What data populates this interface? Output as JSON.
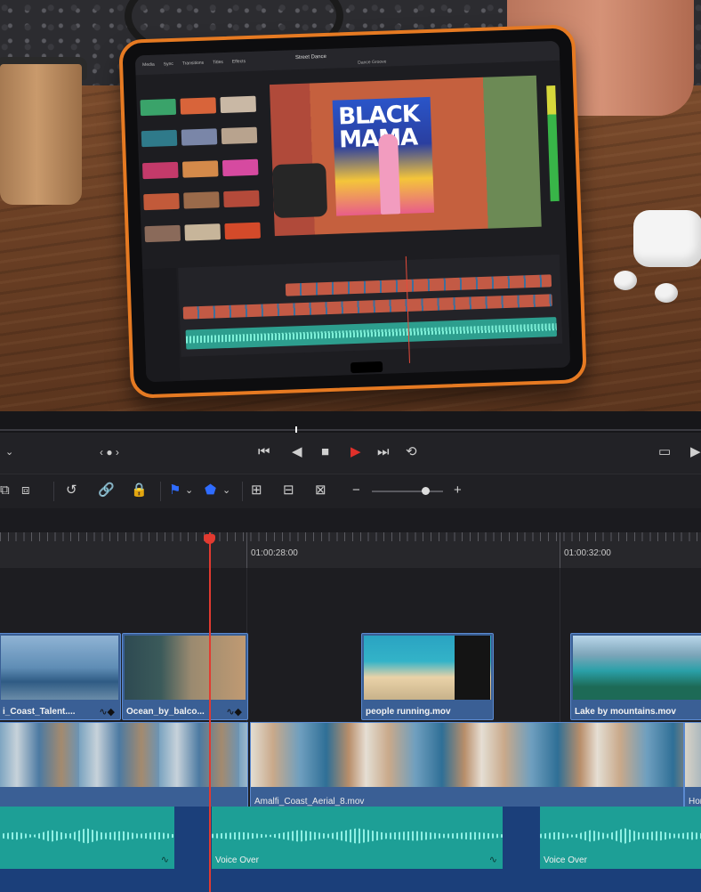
{
  "photo": {
    "ipad_screen": {
      "project_name": "Street Dance",
      "clip_name": "Dance Groove",
      "tabs": [
        "Media",
        "Sync",
        "Transitions",
        "Titles",
        "Effects"
      ],
      "mural_text": "BLACK MAMA"
    }
  },
  "transport": {
    "icons": [
      "chevron-down-icon",
      "prev-next-dots-icon",
      "skip-to-start-icon",
      "step-back-icon",
      "stop-icon",
      "play-icon",
      "skip-to-end-icon",
      "loop-icon",
      "fullscreen-icon",
      "next-frame-icon"
    ],
    "accent": "#e0302a"
  },
  "toolbar": {
    "icons": [
      "insert-clip-icon",
      "overwrite-clip-icon",
      "snapping-icon",
      "link-icon",
      "lock-icon",
      "flag-icon",
      "marker-icon",
      "zoom-full-icon",
      "zoom-detail-icon",
      "zoom-custom-icon",
      "zoom-out-icon",
      "zoom-in-icon"
    ],
    "zoom_minus": "−",
    "zoom_plus": "+",
    "marker_color": "#2f6cff"
  },
  "ruler": {
    "timecodes": [
      "01:00:28:00",
      "01:00:32:00"
    ]
  },
  "timeline": {
    "video2_clips": [
      {
        "label": "i_Coast_Talent...."
      },
      {
        "label": "Ocean_by_balco..."
      },
      {
        "label": "people running.mov"
      },
      {
        "label": "Lake by mountains.mov"
      }
    ],
    "video1_clips": [
      {
        "label": ""
      },
      {
        "label": "Amalfi_Coast_Aerial_8.mov"
      },
      {
        "label": "Hor"
      }
    ],
    "audio_clips": [
      {
        "label": ""
      },
      {
        "label": "Voice Over"
      },
      {
        "label": "Voice Over"
      }
    ],
    "playhead_color": "#e23a30",
    "clip_color": "#3a5f95",
    "audio_color": "#1d9f96"
  }
}
